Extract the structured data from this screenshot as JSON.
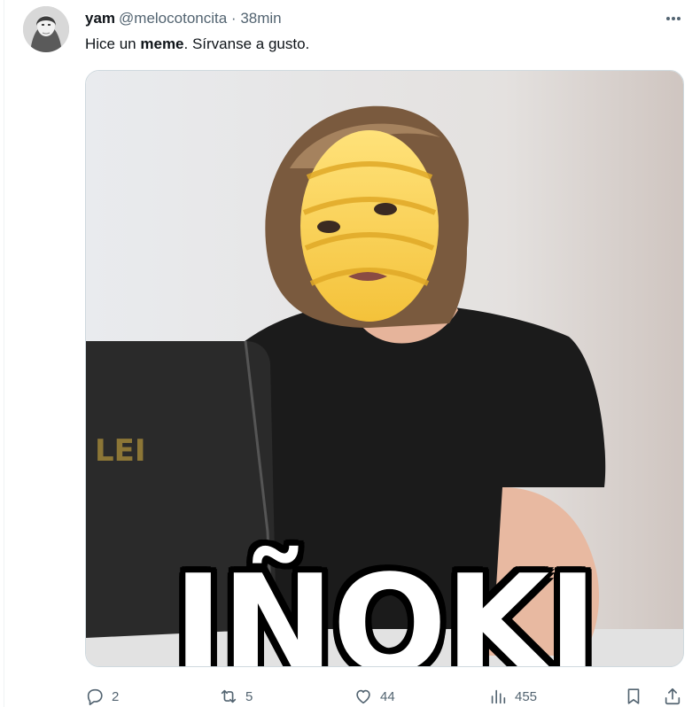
{
  "author": {
    "display_name": "yam",
    "handle": "@melocotoncita",
    "separator": "·",
    "time": "38min"
  },
  "tweet": {
    "text_before": "Hice un ",
    "text_bold": "meme",
    "text_after": ". Sírvanse a gusto."
  },
  "media": {
    "caption": "IÑOKI"
  },
  "actions": {
    "replies": "2",
    "retweets": "5",
    "likes": "44",
    "views": "455"
  },
  "icons": {
    "more": "more-horizontal-icon",
    "reply": "reply-icon",
    "retweet": "retweet-icon",
    "like": "heart-icon",
    "views": "views-icon",
    "bookmark": "bookmark-icon",
    "share": "share-icon"
  },
  "colors": {
    "text": "#0f1419",
    "secondary": "#536471",
    "border": "#cfd9de"
  }
}
